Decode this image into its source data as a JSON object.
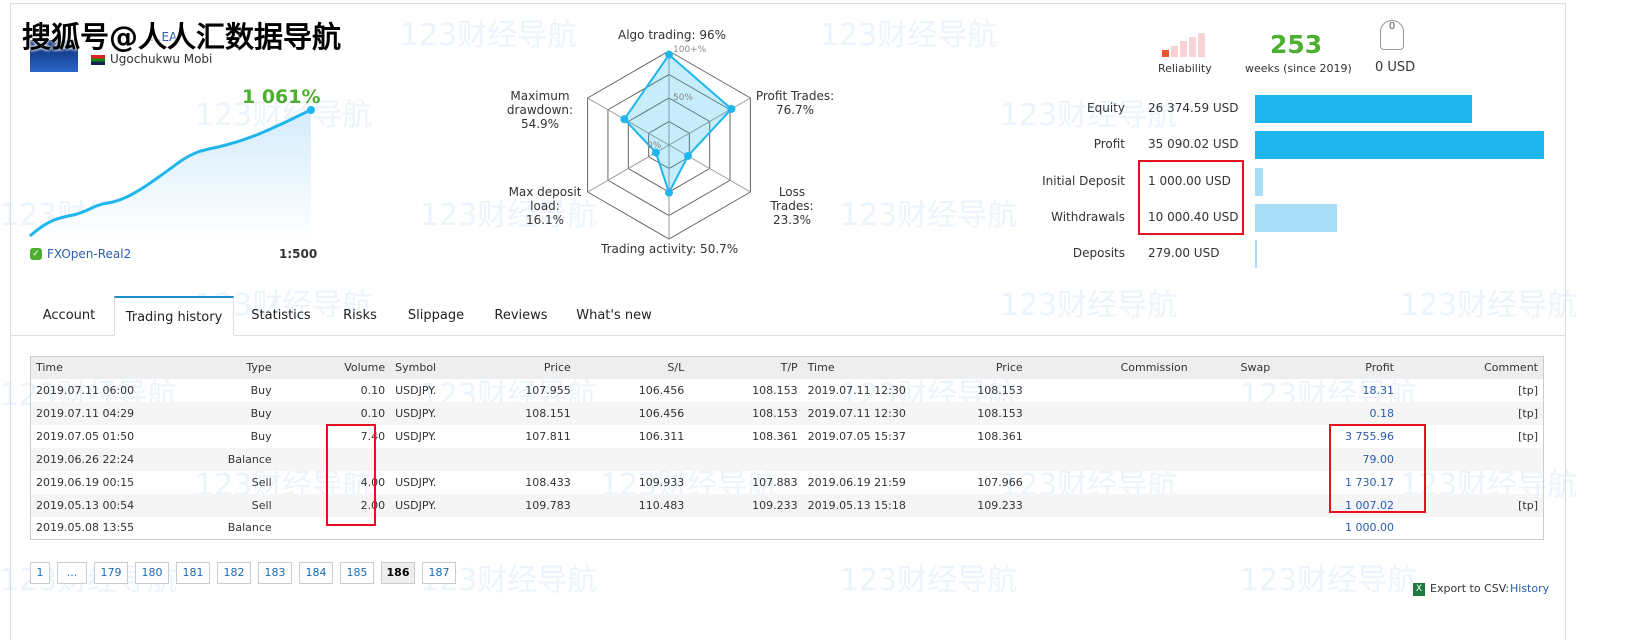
{
  "overlay_text": "搜狐号@人人汇数据导航",
  "watermark": "123财经导航",
  "signal": {
    "name_partial": "...EA",
    "author": "Ugochukwu Mobi",
    "growth": "1 061%",
    "broker": "FXOpen-Real2",
    "leverage": "1:500"
  },
  "radar": {
    "axes": [
      {
        "label": "Algo trading: 96%",
        "value": 96
      },
      {
        "label": "Profit Trades: 76.7%",
        "value": 76.7
      },
      {
        "label": "Loss Trades: 23.3%",
        "value": 23.3
      },
      {
        "label": "Trading activity: 50.7%",
        "value": 50.7
      },
      {
        "label": "Max deposit load: 16.1%",
        "value": 16.1
      },
      {
        "label": "Maximum drawdown: 54.9%",
        "value": 54.9
      }
    ],
    "scale_labels": [
      "100+%",
      "50%",
      "0%"
    ]
  },
  "summary": {
    "reliability": "Reliability",
    "weeks": "253",
    "weeks_label": "weeks (since 2019)",
    "subscribers": "0",
    "subscribers_usd": "0 USD"
  },
  "stats": [
    {
      "label": "Equity",
      "value": "26 374.59 USD",
      "amount": 26374.59,
      "color": "#1fb6ed"
    },
    {
      "label": "Profit",
      "value": "35 090.02 USD",
      "amount": 35090.02,
      "color": "#1fb6ed"
    },
    {
      "label": "Initial Deposit",
      "value": "1 000.00 USD",
      "amount": 1000,
      "color": "#a8def5"
    },
    {
      "label": "Withdrawals",
      "value": "10 000.40 USD",
      "amount": 10000.4,
      "color": "#a8def5"
    },
    {
      "label": "Deposits",
      "value": "279.00 USD",
      "amount": 279,
      "color": "#a8def5"
    }
  ],
  "tabs": [
    "Account",
    "Trading history",
    "Statistics",
    "Risks",
    "Slippage",
    "Reviews",
    "What's new"
  ],
  "table": {
    "headers": [
      "Time",
      "Type",
      "Volume",
      "Symbol",
      "Price",
      "S/L",
      "T/P",
      "Time",
      "Price",
      "Commission",
      "Swap",
      "Profit",
      "Comment"
    ],
    "rows": [
      [
        "2019.07.11 06:00",
        "Buy",
        "0.10",
        "USDJPY.",
        "107.955",
        "106.456",
        "108.153",
        "2019.07.11 12:30",
        "108.153",
        "",
        "",
        "18.31",
        "[tp]"
      ],
      [
        "2019.07.11 04:29",
        "Buy",
        "0.10",
        "USDJPY.",
        "108.151",
        "106.456",
        "108.153",
        "2019.07.11 12:30",
        "108.153",
        "",
        "",
        "0.18",
        "[tp]"
      ],
      [
        "2019.07.05 01:50",
        "Buy",
        "7.40",
        "USDJPY.",
        "107.811",
        "106.311",
        "108.361",
        "2019.07.05 15:37",
        "108.361",
        "",
        "",
        "3 755.96",
        "[tp]"
      ],
      [
        "2019.06.26 22:24",
        "Balance",
        "",
        "",
        "",
        "",
        "",
        "",
        "",
        "",
        "",
        "79.00",
        ""
      ],
      [
        "2019.06.19 00:15",
        "Sell",
        "4.00",
        "USDJPY.",
        "108.433",
        "109.933",
        "107.883",
        "2019.06.19 21:59",
        "107.966",
        "",
        "",
        "1 730.17",
        ""
      ],
      [
        "2019.05.13 00:54",
        "Sell",
        "2.00",
        "USDJPY.",
        "109.783",
        "110.483",
        "109.233",
        "2019.05.13 15:18",
        "109.233",
        "",
        "",
        "1 007.02",
        "[tp]"
      ],
      [
        "2019.05.08 13:55",
        "Balance",
        "",
        "",
        "",
        "",
        "",
        "",
        "",
        "",
        "",
        "1 000.00",
        ""
      ]
    ]
  },
  "pagination": {
    "pages": [
      "1",
      "...",
      "179",
      "180",
      "181",
      "182",
      "183",
      "184",
      "185",
      "186",
      "187"
    ],
    "current": "186"
  },
  "export": {
    "label": "Export to CSV:",
    "link": "History"
  }
}
